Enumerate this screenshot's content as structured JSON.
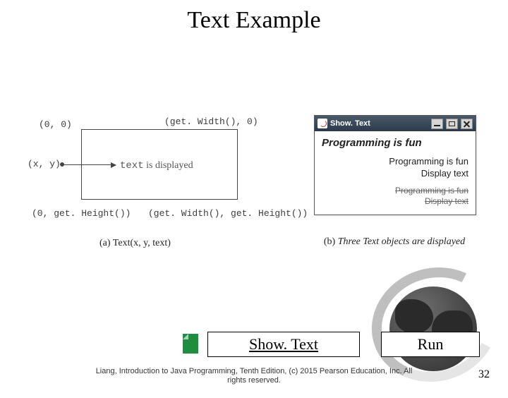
{
  "title": "Text Example",
  "diagram": {
    "coord_origin": "(0, 0)",
    "coord_topright": "(get. Width(), 0)",
    "coord_xy": "(x, y)",
    "text_displayed_code": "text",
    "text_displayed_rest": " is displayed",
    "coord_bottomleft": "(0, get. Height())",
    "coord_bottomright": "(get. Width(), get. Height())",
    "caption": "(a) Text(x, y, text)"
  },
  "window": {
    "title": "Show. Text",
    "line1": "Programming is fun",
    "line2a": "Programming is fun",
    "line2b": "Display text",
    "line3a": "Programming is fun",
    "line3b": "Display text",
    "caption_label": "(b) ",
    "caption_text": "Three Text objects are displayed"
  },
  "buttons": {
    "show_label": "Show. Text",
    "run_label": "Run"
  },
  "footer": {
    "line1": "Liang, Introduction to Java Programming, Tenth Edition, (c) 2015 Pearson Education, Inc. All",
    "line2": "rights reserved."
  },
  "page_number": "32"
}
